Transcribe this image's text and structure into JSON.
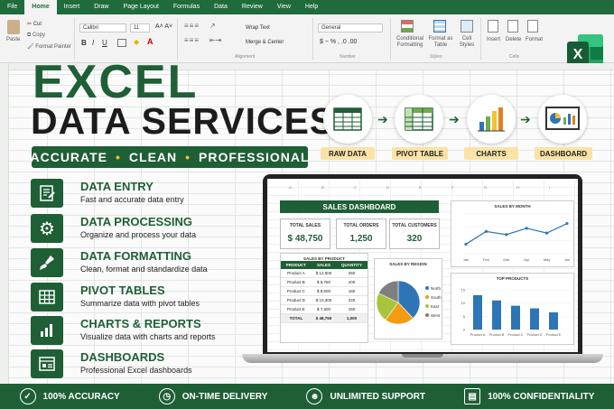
{
  "menu": {
    "tabs": [
      "File",
      "Home",
      "Insert",
      "Draw",
      "Page Layout",
      "Formulas",
      "Data",
      "Review",
      "View",
      "Help"
    ],
    "active_index": 1
  },
  "ribbon": {
    "paste": "Paste",
    "cut": "Cut",
    "copy": "Copy",
    "format_painter": "Format Painter",
    "font": "Calibri",
    "font_size": "11",
    "wrap_text": "Wrap Text",
    "merge_center": "Merge & Center",
    "number_format": "General",
    "conditional": "Conditional Formatting",
    "format_table": "Format as Table",
    "cell_styles": "Cell Styles",
    "insert": "Insert",
    "delete": "Delete",
    "format": "Format",
    "groups": [
      "Alignment",
      "Number",
      "Styles",
      "Cells"
    ]
  },
  "hero": {
    "line1": "EXCEL",
    "line2": "DATA SERVICES",
    "tag": [
      "ACCURATE",
      "CLEAN",
      "PROFESSIONAL"
    ]
  },
  "process": [
    {
      "label": "RAW DATA"
    },
    {
      "label": "PIVOT TABLE"
    },
    {
      "label": "CHARTS"
    },
    {
      "label": "DASHBOARD"
    }
  ],
  "services": [
    {
      "name": "DATA ENTRY",
      "desc": "Fast and accurate data entry",
      "icon": "form-icon"
    },
    {
      "name": "DATA PROCESSING",
      "desc": "Organize and process your data",
      "icon": "gear-icon"
    },
    {
      "name": "DATA FORMATTING",
      "desc": "Clean, format and standardize data",
      "icon": "brush-icon"
    },
    {
      "name": "PIVOT TABLES",
      "desc": "Summarize data with pivot tables",
      "icon": "table-icon"
    },
    {
      "name": "CHARTS & REPORTS",
      "desc": "Visualize data with charts and reports",
      "icon": "bar-chart-icon"
    },
    {
      "name": "DASHBOARDS",
      "desc": "Professional Excel dashboards",
      "icon": "dashboard-icon"
    }
  ],
  "dashboard": {
    "title": "SALES DASHBOARD",
    "kpis": [
      {
        "label": "TOTAL SALES",
        "value": "$ 48,750"
      },
      {
        "label": "TOTAL ORDERS",
        "value": "1,250"
      },
      {
        "label": "TOTAL CUSTOMERS",
        "value": "320"
      }
    ],
    "col_letters": [
      "A",
      "B",
      "C",
      "D",
      "E",
      "F",
      "G",
      "H",
      "I"
    ],
    "by_product": {
      "title": "SALES BY PRODUCT",
      "headers": [
        "PRODUCT",
        "SALES",
        "QUANTITY"
      ],
      "rows": [
        [
          "Product A",
          "$ 12,500",
          "250"
        ],
        [
          "Product B",
          "$ 9,750",
          "200"
        ],
        [
          "Product C",
          "$ 8,600",
          "180"
        ],
        [
          "Product D",
          "$ 10,300",
          "220"
        ],
        [
          "Product E",
          "$ 7,600",
          "150"
        ]
      ],
      "total": [
        "TOTAL",
        "$ 48,750",
        "1,000"
      ]
    },
    "by_region": {
      "title": "SALES BY REGION",
      "legend": [
        "North",
        "South",
        "East",
        "West"
      ],
      "colors": [
        "#2e75b6",
        "#f39c12",
        "#a8c43b",
        "#7f7f7f"
      ],
      "values": [
        38,
        22,
        22,
        18
      ]
    },
    "by_month": {
      "title": "SALES BY MONTH",
      "months": [
        "Jan",
        "Feb",
        "Mar",
        "Apr",
        "May",
        "Jun"
      ],
      "values": [
        32,
        48,
        44,
        52,
        46,
        58
      ]
    },
    "top_products": {
      "title": "TOP PRODUCTS",
      "categories": [
        "Product A",
        "Product B",
        "Product C",
        "Product D",
        "Product E"
      ],
      "values": [
        13,
        11,
        9,
        8,
        6.5
      ],
      "ticks": [
        "0",
        "5",
        "10",
        "15"
      ]
    }
  },
  "footer": [
    {
      "label": "100% ACCURACY",
      "icon": "check-circle-icon"
    },
    {
      "label": "ON-TIME DELIVERY",
      "icon": "clock-icon"
    },
    {
      "label": "UNLIMITED SUPPORT",
      "icon": "user-support-icon"
    },
    {
      "label": "100% CONFIDENTIALITY",
      "icon": "document-icon"
    }
  ]
}
